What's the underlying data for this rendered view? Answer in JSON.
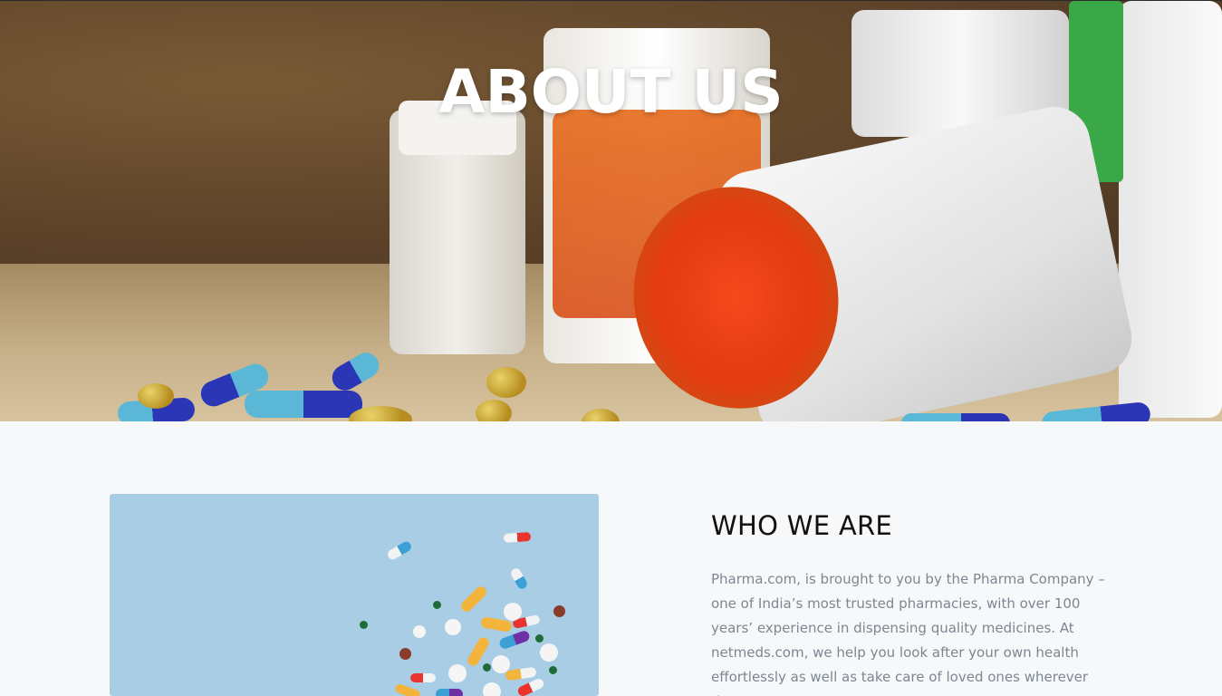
{
  "hero": {
    "title": "ABOUT US",
    "image_desc_icon": "pill-bottles-image"
  },
  "about": {
    "heading": "WHO WE ARE",
    "paragraph": "Pharma.com, is brought to you by the Pharma Company – one of India’s most trusted pharmacies, with over 100 years’ experience in dispensing quality medicines. At netmeds.com, we help you look after your own health effortlessly as well as take care of loved ones wherever they"
  },
  "colors": {
    "page_bg": "#f7f8fa",
    "heading": "#111111",
    "body_text": "#7c8792",
    "photo_bg": "#a9cde4"
  }
}
